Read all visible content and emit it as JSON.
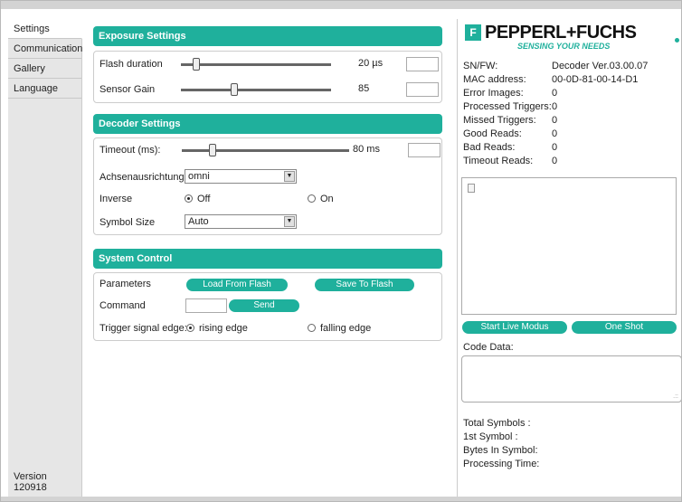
{
  "sidebar": {
    "items": [
      {
        "label": "Settings"
      },
      {
        "label": "Communication"
      },
      {
        "label": "Gallery"
      },
      {
        "label": "Language"
      }
    ],
    "version": "Version 120918"
  },
  "exposure": {
    "title": "Exposure Settings",
    "flash_label": "Flash duration",
    "flash_value": "20 µs",
    "flash_level": 0.08,
    "gain_label": "Sensor Gain",
    "gain_value": "85",
    "gain_level": 0.35
  },
  "decoder": {
    "title": "Decoder Settings",
    "timeout_label": "Timeout (ms):",
    "timeout_value": "80 ms",
    "timeout_level": 0.17,
    "orientation_label": "Achsenausrichtung",
    "orientation_value": "omni",
    "inverse_label": "Inverse",
    "inverse_off": "Off",
    "inverse_on": "On",
    "symbol_size_label": "Symbol Size",
    "symbol_size_value": "Auto"
  },
  "system": {
    "title": "System Control",
    "parameters_label": "Parameters",
    "load_button": "Load From Flash",
    "save_button": "Save To Flash",
    "command_label": "Command",
    "send_button": "Send",
    "trigger_label": "Trigger signal edge:",
    "rising": "rising edge",
    "falling": "falling edge"
  },
  "brand": {
    "logo_mark": "F",
    "name": "PEPPERL+FUCHS",
    "tagline": "SENSING YOUR NEEDS",
    "accent_color": "#1fb09c"
  },
  "device": {
    "rows": [
      {
        "label": "SN/FW:",
        "value": "Decoder Ver.03.00.07"
      },
      {
        "label": "MAC address:",
        "value": "00-0D-81-00-14-D1"
      },
      {
        "label": "Error Images:",
        "value": "0"
      },
      {
        "label": "Processed Triggers:",
        "value": "0"
      },
      {
        "label": "Missed Triggers:",
        "value": "0"
      },
      {
        "label": "Good Reads:",
        "value": "0"
      },
      {
        "label": "Bad Reads:",
        "value": "0"
      },
      {
        "label": "Timeout Reads:",
        "value": "0"
      }
    ]
  },
  "viewer": {
    "live_button": "Start Live Modus",
    "oneshot_button": "One Shot",
    "code_data_label": "Code Data:"
  },
  "stats": {
    "total_symbols": "Total Symbols :",
    "first_symbol": "1st Symbol :",
    "bytes_in_symbol": "Bytes In Symbol:",
    "processing_time": "Processing Time:"
  }
}
